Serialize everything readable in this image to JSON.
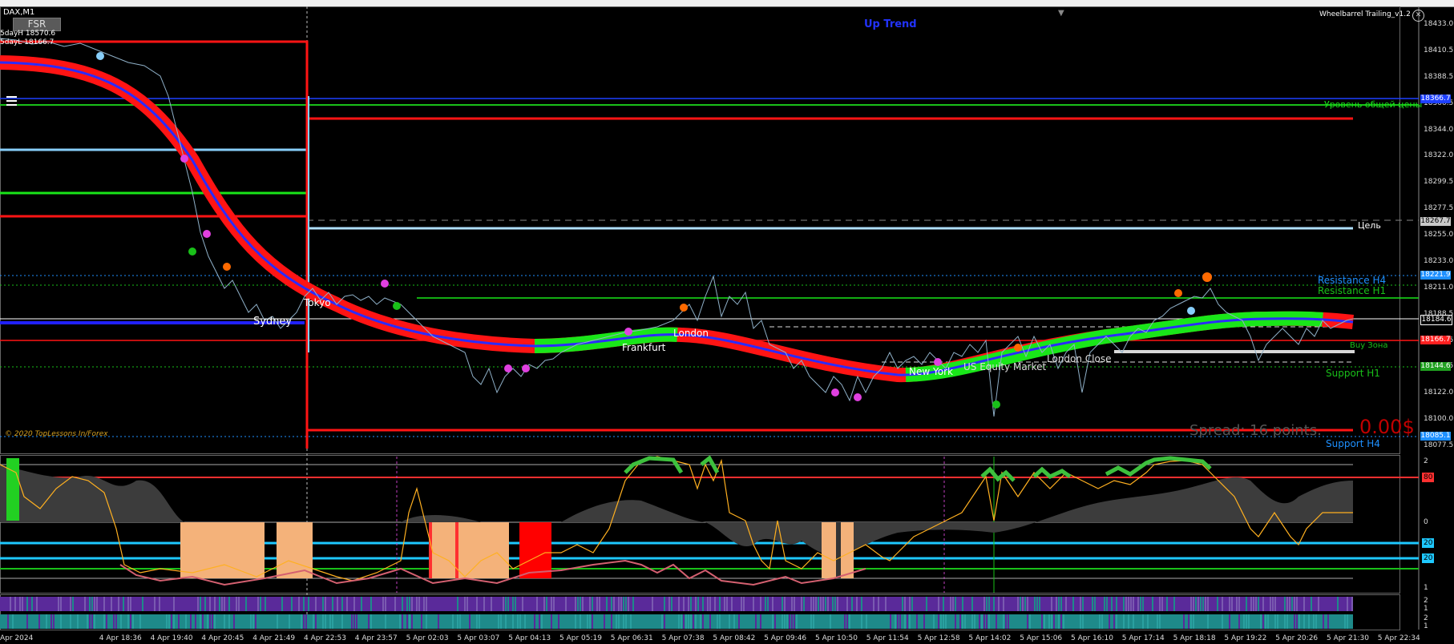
{
  "window": {
    "symbol_title": "DAX,M1",
    "indicator_title": "Wheelbarrel Trailing_v1.2",
    "trend_label": "Up Trend",
    "fsr_button": "FSR",
    "day_high": "5dayH 18570.6",
    "day_low": "5dayL 18166.7",
    "copyright": "© 2020 TopLessons In/Forex",
    "spread_text": "Spread: 16 points.",
    "profit_text": "0.00$"
  },
  "labels": {
    "equilibrium": "Уровень общей цены",
    "target": "Цель",
    "resistance_h4": "Resistance H4",
    "resistance_h1": "Resistance H1",
    "buy_zone": "Buy Зона",
    "support_h1": "Support H1",
    "support_h4": "Support H4"
  },
  "sessions": [
    "Sydney",
    "Tokyo",
    "Frankfurt",
    "London",
    "New York",
    "US Equity Market",
    "London Close"
  ],
  "price_axis": {
    "ticks": [
      "18433.0",
      "18410.5",
      "18388.5",
      "18366.5",
      "18344.0",
      "18322.0",
      "18299.5",
      "18277.5",
      "18255.0",
      "18233.0",
      "18211.0",
      "18188.5",
      "18166.5",
      "18144.5",
      "18122.0",
      "18100.0",
      "18077.5"
    ],
    "tags": [
      {
        "value": "18366.7",
        "color": "#1e40ff"
      },
      {
        "value": "18267.7",
        "color": "#c8c8c8"
      },
      {
        "value": "18221.9",
        "color": "#1e90ff"
      },
      {
        "value": "18184.6",
        "color": "#ffffff"
      },
      {
        "value": "18166.7",
        "color": "#ff2020"
      },
      {
        "value": "18144.6",
        "color": "#20a020"
      },
      {
        "value": "18085.1",
        "color": "#1e90ff"
      }
    ]
  },
  "oscillator_axis": [
    "2",
    "80",
    "0",
    "20",
    "20",
    "1"
  ],
  "strip_axis": [
    "2",
    "1",
    "2",
    "1"
  ],
  "time_axis": [
    "Apr 2024",
    "4 Apr 18:36",
    "4 Apr 19:40",
    "4 Apr 20:45",
    "4 Apr 21:49",
    "4 Apr 22:53",
    "4 Apr 23:57",
    "5 Apr 02:03",
    "5 Apr 03:07",
    "5 Apr 04:13",
    "5 Apr 05:19",
    "5 Apr 06:31",
    "5 Apr 07:38",
    "5 Apr 08:42",
    "5 Apr 09:46",
    "5 Apr 10:50",
    "5 Apr 11:54",
    "5 Apr 12:58",
    "5 Apr 14:02",
    "5 Apr 15:06",
    "5 Apr 16:10",
    "5 Apr 17:14",
    "5 Apr 18:18",
    "5 Apr 19:22",
    "5 Apr 20:26",
    "5 Apr 21:30",
    "5 Apr 22:34"
  ],
  "colors": {
    "up": "#19e619",
    "down": "#ff1414",
    "ma": "#2b2bff",
    "price": "#8fb0c8"
  }
}
